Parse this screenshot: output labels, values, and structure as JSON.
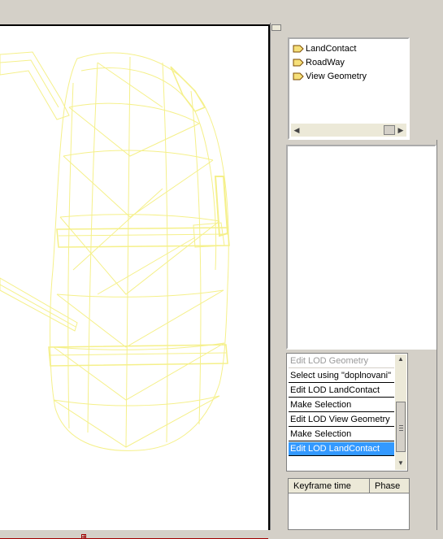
{
  "tree": {
    "items": [
      {
        "label": "LandContact",
        "icon": "lod-icon"
      },
      {
        "label": "RoadWay",
        "icon": "lod-icon"
      },
      {
        "label": "View Geometry",
        "icon": "lod-icon"
      }
    ]
  },
  "history": {
    "items": [
      {
        "label": "Edit LOD Geometry",
        "state": "dim"
      },
      {
        "label": "Select using \"doplnovani\"",
        "state": "normal"
      },
      {
        "label": "Edit LOD LandContact",
        "state": "normal"
      },
      {
        "label": "Make Selection",
        "state": "normal"
      },
      {
        "label": "Edit LOD View Geometry",
        "state": "normal"
      },
      {
        "label": "Make Selection",
        "state": "normal"
      },
      {
        "label": "Edit LOD LandContact",
        "state": "selected"
      }
    ]
  },
  "keyframes": {
    "columns": [
      "Keyframe time",
      "Phase"
    ]
  },
  "colors": {
    "wireframe": "#f5f08a",
    "selection": "#3399ff",
    "axis": "#a00000"
  }
}
